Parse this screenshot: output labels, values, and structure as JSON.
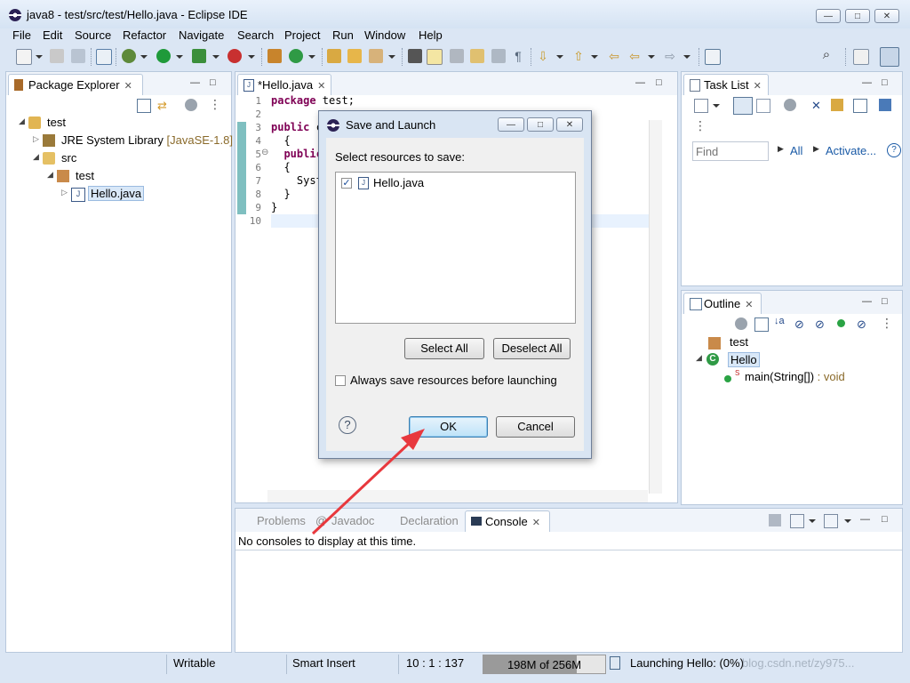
{
  "window": {
    "title": "java8 - test/src/test/Hello.java - Eclipse IDE"
  },
  "menu": [
    "File",
    "Edit",
    "Source",
    "Refactor",
    "Navigate",
    "Search",
    "Project",
    "Run",
    "Window",
    "Help"
  ],
  "package_explorer": {
    "tab": "Package Explorer",
    "tree": {
      "project": "test",
      "jre": "JRE System Library",
      "jre_version": "[JavaSE-1.8]",
      "src": "src",
      "package": "test",
      "file": "Hello.java"
    }
  },
  "editor": {
    "tab": "*Hello.java",
    "line_numbers": [
      "1",
      "2",
      "3",
      "4",
      "5",
      "6",
      "7",
      "8",
      "9",
      "10"
    ],
    "lines": [
      "package test;",
      "",
      "public c",
      "  {",
      "  public",
      "  {",
      "    Syst",
      "  }",
      "}",
      ""
    ]
  },
  "task_list": {
    "tab": "Task List",
    "find_placeholder": "Find",
    "all": "All",
    "activate": "Activate..."
  },
  "outline": {
    "tab": "Outline",
    "package": "test",
    "class": "Hello",
    "method": "main(String[])",
    "return_type": " : void"
  },
  "bottom_tabs": {
    "problems": "Problems",
    "javadoc": "Javadoc",
    "declaration": "Declaration",
    "console": "Console"
  },
  "console": {
    "message": "No consoles to display at this time."
  },
  "dialog": {
    "title": "Save and Launch",
    "prompt": "Select resources to save:",
    "resources": [
      {
        "name": "Hello.java",
        "checked": true
      }
    ],
    "select_all": "Select All",
    "deselect_all": "Deselect All",
    "always_save": "Always save resources before launching",
    "ok": "OK",
    "cancel": "Cancel"
  },
  "status": {
    "writable": "Writable",
    "insert_mode": "Smart Insert",
    "position": "10 : 1 : 137",
    "heap": "198M of 256M",
    "heap_fraction": 0.77,
    "launching": "Launching Hello: (0%)",
    "watermark": "blog.csdn.net/zy975..."
  },
  "colors": {
    "arrow": "#e8383d",
    "heap_fill": "#9a9a9a",
    "keyword": "#7f0055",
    "line_marker": "#7fbfc0"
  }
}
